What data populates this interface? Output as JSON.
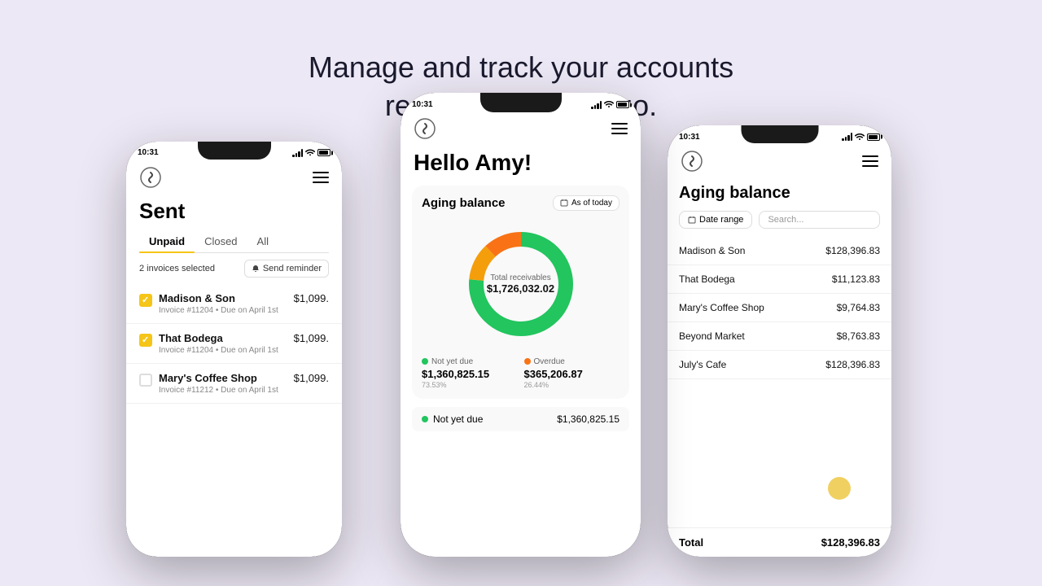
{
  "headline": {
    "line1": "Manage and track your accounts",
    "line2": "receivable on the go."
  },
  "left_phone": {
    "status_time": "10:31",
    "title": "Sent",
    "tabs": [
      "Unpaid",
      "Closed",
      "All"
    ],
    "active_tab": "Unpaid",
    "selected_count": "2 invoices selected",
    "send_reminder_label": "Send reminder",
    "invoices": [
      {
        "name": "Madison & Son",
        "invoice": "Invoice #11204",
        "due": "Due on April 1st",
        "amount": "$1,099.",
        "checked": true
      },
      {
        "name": "That Bodega",
        "invoice": "Invoice #11204",
        "due": "Due on April 1st",
        "amount": "$1,099.",
        "checked": true
      },
      {
        "name": "Mary's Coffee Shop",
        "invoice": "Invoice #11212",
        "due": "Due on April 1st",
        "amount": "$1,099.",
        "checked": false
      }
    ]
  },
  "center_phone": {
    "status_time": "10:31",
    "greeting": "Hello Amy!",
    "aging_balance_title": "Aging balance",
    "as_of_today": "As of today",
    "total_label": "Total receivables",
    "total_amount": "$1,726,032.02",
    "not_yet_due_label": "Not yet due",
    "not_yet_due_amount": "$1,360,825.15",
    "not_yet_due_pct": "73.53%",
    "overdue_label": "Overdue",
    "overdue_amount": "$365,206.87",
    "overdue_pct": "26.44%",
    "bottom_not_yet_due_label": "Not yet due",
    "bottom_not_yet_due_amount": "$1,360,825.15"
  },
  "right_phone": {
    "status_time": "10:31",
    "aging_balance_title": "Aging balance",
    "date_range_label": "Date range",
    "search_placeholder": "Search...",
    "clients": [
      {
        "name": "Madison & Son",
        "amount": "$128,396.83"
      },
      {
        "name": "That Bodega",
        "amount": "$11,123.83"
      },
      {
        "name": "Mary's Coffee Shop",
        "amount": "$9,764.83"
      },
      {
        "name": "Beyond Market",
        "amount": "$8,763.83"
      },
      {
        "name": "July's Cafe",
        "amount": "$128,396.83"
      }
    ],
    "total_label": "Total",
    "total_amount": "$128,396.83"
  },
  "colors": {
    "green": "#22c55e",
    "orange": "#f97316",
    "yellow_orange": "#f59e0b",
    "accent_yellow": "#f5c518",
    "background": "#ede8f5"
  }
}
